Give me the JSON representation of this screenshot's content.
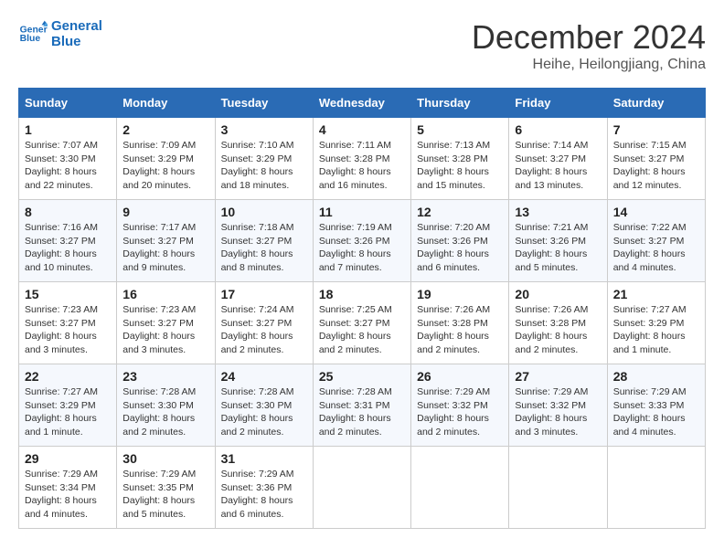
{
  "header": {
    "logo_line1": "General",
    "logo_line2": "Blue",
    "month_title": "December 2024",
    "location": "Heihe, Heilongjiang, China"
  },
  "days_of_week": [
    "Sunday",
    "Monday",
    "Tuesday",
    "Wednesday",
    "Thursday",
    "Friday",
    "Saturday"
  ],
  "weeks": [
    [
      {
        "day": "1",
        "info": "Sunrise: 7:07 AM\nSunset: 3:30 PM\nDaylight: 8 hours\nand 22 minutes."
      },
      {
        "day": "2",
        "info": "Sunrise: 7:09 AM\nSunset: 3:29 PM\nDaylight: 8 hours\nand 20 minutes."
      },
      {
        "day": "3",
        "info": "Sunrise: 7:10 AM\nSunset: 3:29 PM\nDaylight: 8 hours\nand 18 minutes."
      },
      {
        "day": "4",
        "info": "Sunrise: 7:11 AM\nSunset: 3:28 PM\nDaylight: 8 hours\nand 16 minutes."
      },
      {
        "day": "5",
        "info": "Sunrise: 7:13 AM\nSunset: 3:28 PM\nDaylight: 8 hours\nand 15 minutes."
      },
      {
        "day": "6",
        "info": "Sunrise: 7:14 AM\nSunset: 3:27 PM\nDaylight: 8 hours\nand 13 minutes."
      },
      {
        "day": "7",
        "info": "Sunrise: 7:15 AM\nSunset: 3:27 PM\nDaylight: 8 hours\nand 12 minutes."
      }
    ],
    [
      {
        "day": "8",
        "info": "Sunrise: 7:16 AM\nSunset: 3:27 PM\nDaylight: 8 hours\nand 10 minutes."
      },
      {
        "day": "9",
        "info": "Sunrise: 7:17 AM\nSunset: 3:27 PM\nDaylight: 8 hours\nand 9 minutes."
      },
      {
        "day": "10",
        "info": "Sunrise: 7:18 AM\nSunset: 3:27 PM\nDaylight: 8 hours\nand 8 minutes."
      },
      {
        "day": "11",
        "info": "Sunrise: 7:19 AM\nSunset: 3:26 PM\nDaylight: 8 hours\nand 7 minutes."
      },
      {
        "day": "12",
        "info": "Sunrise: 7:20 AM\nSunset: 3:26 PM\nDaylight: 8 hours\nand 6 minutes."
      },
      {
        "day": "13",
        "info": "Sunrise: 7:21 AM\nSunset: 3:26 PM\nDaylight: 8 hours\nand 5 minutes."
      },
      {
        "day": "14",
        "info": "Sunrise: 7:22 AM\nSunset: 3:27 PM\nDaylight: 8 hours\nand 4 minutes."
      }
    ],
    [
      {
        "day": "15",
        "info": "Sunrise: 7:23 AM\nSunset: 3:27 PM\nDaylight: 8 hours\nand 3 minutes."
      },
      {
        "day": "16",
        "info": "Sunrise: 7:23 AM\nSunset: 3:27 PM\nDaylight: 8 hours\nand 3 minutes."
      },
      {
        "day": "17",
        "info": "Sunrise: 7:24 AM\nSunset: 3:27 PM\nDaylight: 8 hours\nand 2 minutes."
      },
      {
        "day": "18",
        "info": "Sunrise: 7:25 AM\nSunset: 3:27 PM\nDaylight: 8 hours\nand 2 minutes."
      },
      {
        "day": "19",
        "info": "Sunrise: 7:26 AM\nSunset: 3:28 PM\nDaylight: 8 hours\nand 2 minutes."
      },
      {
        "day": "20",
        "info": "Sunrise: 7:26 AM\nSunset: 3:28 PM\nDaylight: 8 hours\nand 2 minutes."
      },
      {
        "day": "21",
        "info": "Sunrise: 7:27 AM\nSunset: 3:29 PM\nDaylight: 8 hours\nand 1 minute."
      }
    ],
    [
      {
        "day": "22",
        "info": "Sunrise: 7:27 AM\nSunset: 3:29 PM\nDaylight: 8 hours\nand 1 minute."
      },
      {
        "day": "23",
        "info": "Sunrise: 7:28 AM\nSunset: 3:30 PM\nDaylight: 8 hours\nand 2 minutes."
      },
      {
        "day": "24",
        "info": "Sunrise: 7:28 AM\nSunset: 3:30 PM\nDaylight: 8 hours\nand 2 minutes."
      },
      {
        "day": "25",
        "info": "Sunrise: 7:28 AM\nSunset: 3:31 PM\nDaylight: 8 hours\nand 2 minutes."
      },
      {
        "day": "26",
        "info": "Sunrise: 7:29 AM\nSunset: 3:32 PM\nDaylight: 8 hours\nand 2 minutes."
      },
      {
        "day": "27",
        "info": "Sunrise: 7:29 AM\nSunset: 3:32 PM\nDaylight: 8 hours\nand 3 minutes."
      },
      {
        "day": "28",
        "info": "Sunrise: 7:29 AM\nSunset: 3:33 PM\nDaylight: 8 hours\nand 4 minutes."
      }
    ],
    [
      {
        "day": "29",
        "info": "Sunrise: 7:29 AM\nSunset: 3:34 PM\nDaylight: 8 hours\nand 4 minutes."
      },
      {
        "day": "30",
        "info": "Sunrise: 7:29 AM\nSunset: 3:35 PM\nDaylight: 8 hours\nand 5 minutes."
      },
      {
        "day": "31",
        "info": "Sunrise: 7:29 AM\nSunset: 3:36 PM\nDaylight: 8 hours\nand 6 minutes."
      },
      {
        "day": "",
        "info": ""
      },
      {
        "day": "",
        "info": ""
      },
      {
        "day": "",
        "info": ""
      },
      {
        "day": "",
        "info": ""
      }
    ]
  ]
}
